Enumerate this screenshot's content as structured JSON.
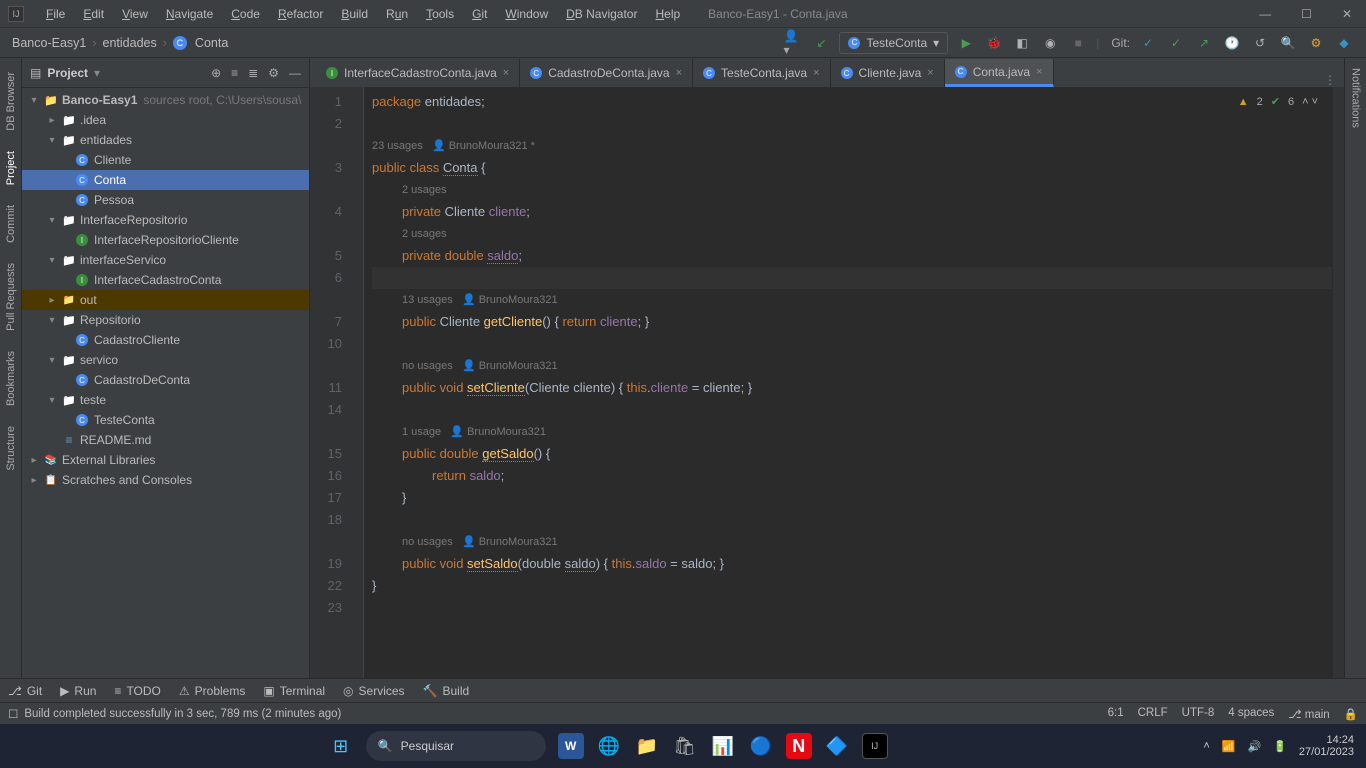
{
  "window": {
    "title": "Banco-Easy1 - Conta.java"
  },
  "menu": [
    "File",
    "Edit",
    "View",
    "Navigate",
    "Code",
    "Refactor",
    "Build",
    "Run",
    "Tools",
    "Git",
    "Window",
    "DB Navigator",
    "Help"
  ],
  "breadcrumb": {
    "project": "Banco-Easy1",
    "package": "entidades",
    "class": "Conta"
  },
  "runConfig": "TesteConta",
  "gitLabel": "Git:",
  "projectPanel": {
    "title": "Project",
    "sourcesHint": "sources root,  C:\\Users\\sousa\\",
    "tree": {
      "root": "Banco-Easy1",
      "idea": ".idea",
      "entidades": "entidades",
      "entidades_children": [
        "Cliente",
        "Conta",
        "Pessoa"
      ],
      "interfaceRepositorio": "InterfaceRepositorio",
      "interfaceRepositorio_children": [
        "InterfaceRepositorioCliente"
      ],
      "interfaceServico": "interfaceServico",
      "interfaceServico_children": [
        "InterfaceCadastroConta"
      ],
      "out": "out",
      "repositorio": "Repositorio",
      "repositorio_children": [
        "CadastroCliente"
      ],
      "servico": "servico",
      "servico_children": [
        "CadastroDeConta"
      ],
      "teste": "teste",
      "teste_children": [
        "TesteConta"
      ],
      "readme": "README.md",
      "externalLibs": "External Libraries",
      "scratches": "Scratches and Consoles"
    }
  },
  "leftRail": [
    "DB Browser",
    "Project",
    "Commit",
    "Pull Requests",
    "Bookmarks",
    "Structure"
  ],
  "rightRail": [
    "Notifications"
  ],
  "editorTabs": [
    {
      "icon": "I",
      "label": "InterfaceCadastroConta.java"
    },
    {
      "icon": "C",
      "label": "CadastroDeConta.java"
    },
    {
      "icon": "C",
      "label": "TesteConta.java"
    },
    {
      "icon": "C",
      "label": "Cliente.java"
    },
    {
      "icon": "C",
      "label": "Conta.java",
      "active": true
    }
  ],
  "inspections": {
    "warnings": "2",
    "passes": "6"
  },
  "code": {
    "l1a": "package ",
    "l1b": "entidades;",
    "h1": "23 usages",
    "h1b": "BrunoMoura321 *",
    "l3": "public class ",
    "l3b": "Conta",
    " l3c": " {",
    "h2": "2 usages",
    "l4": "private ",
    "l4b": "Cliente ",
    "l4c": "cliente",
    ";": ";",
    "h3": "2 usages",
    "l5": "private double ",
    "l5b": "saldo",
    "h4": "13 usages",
    "h4b": "BrunoMoura321",
    "l7": "public ",
    "l7t": "Cliente ",
    "l7m": "getCliente",
    "l7p": "() { ",
    "l7r": "return ",
    "l7f": "cliente",
    "l7e": "; }",
    "h5": "no usages",
    "h5b": "BrunoMoura321",
    "l11": "public void ",
    "l11m": "setCliente",
    "l11p": "(Cliente cliente) { ",
    "l11t": "this",
    "l11d": ".",
    "l11f": "cliente",
    "l11e": " = cliente; }",
    "h6": "1 usage",
    "h6b": "BrunoMoura321",
    "l15": "public double ",
    "l15m": "getSaldo",
    "l15p": "() {",
    "l16": "return ",
    "l16f": "saldo",
    "l16e": ";",
    "l17": "}",
    "h7": "no usages",
    "h7b": "BrunoMoura321",
    "l19": "public void ",
    "l19m": "setSaldo",
    "l19p": "(double ",
    "l19a": "saldo",
    "l19q": ") { ",
    "l19t": "this",
    "l19d": ".",
    "l19f": "saldo",
    "l19e": " = saldo; }",
    "l22": "}"
  },
  "gutterLines": [
    "1",
    "2",
    "",
    "3",
    "",
    "4",
    "",
    "5",
    "6",
    "",
    "7",
    "10",
    "",
    "11",
    "14",
    "",
    "15",
    "16",
    "17",
    "18",
    "",
    "19",
    "22",
    "23"
  ],
  "bottomPanel": {
    "git": "Git",
    "run": "Run",
    "todo": "TODO",
    "problems": "Problems",
    "terminal": "Terminal",
    "services": "Services",
    "build": "Build"
  },
  "statusBar": {
    "msg": "Build completed successfully in 3 sec, 789 ms (2 minutes ago)",
    "pos": "6:1",
    "lineSep": "CRLF",
    "enc": "UTF-8",
    "indent": "4 spaces",
    "branch": "main"
  },
  "taskbar": {
    "search": "Pesquisar",
    "time": "14:24",
    "date": "27/01/2023"
  }
}
